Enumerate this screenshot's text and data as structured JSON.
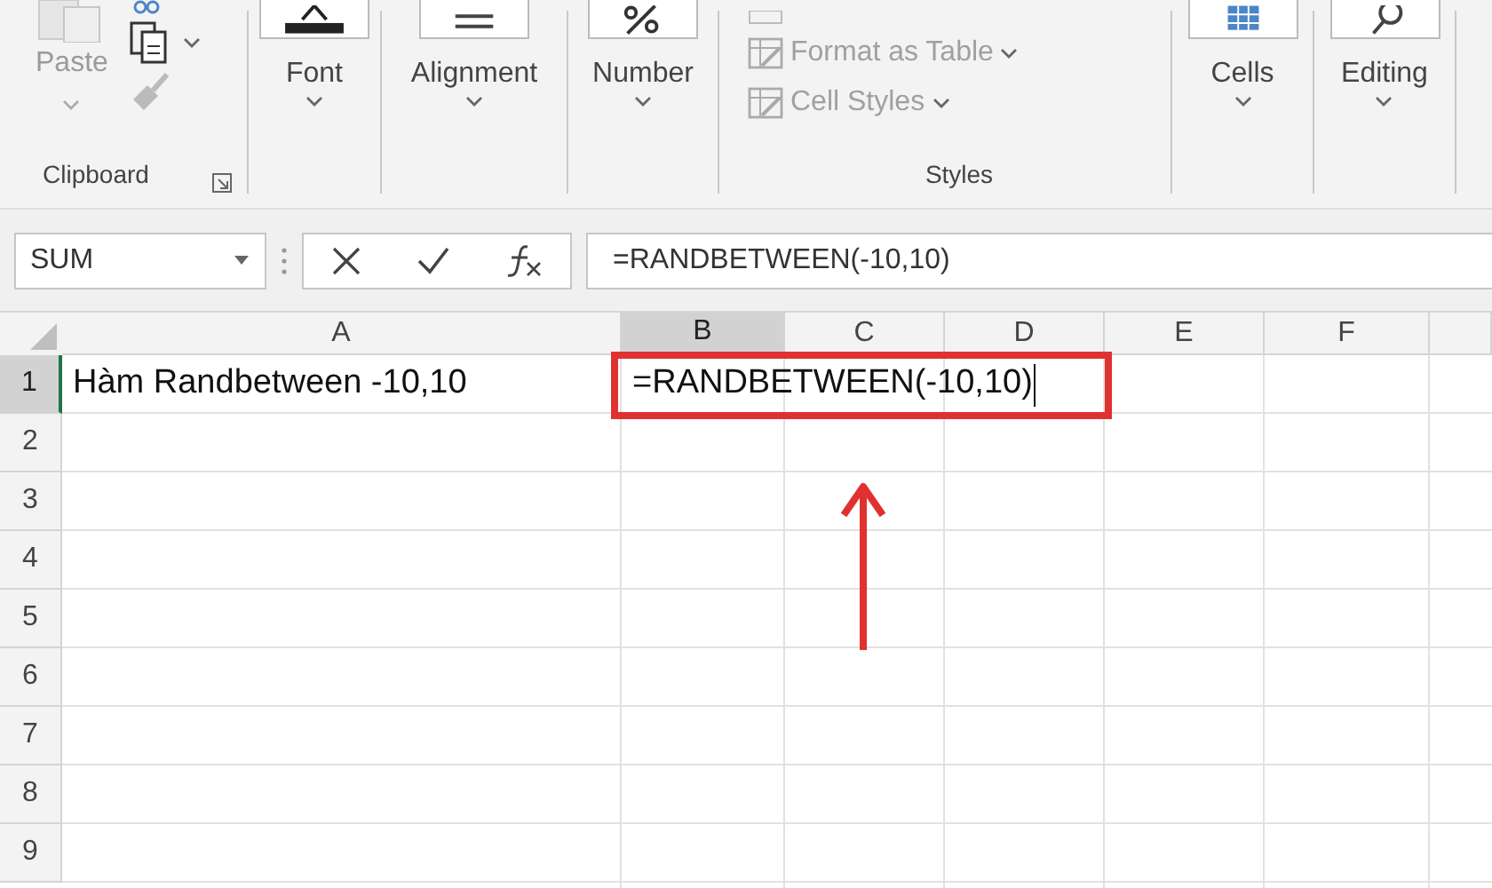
{
  "ribbon": {
    "groups": [
      {
        "kind": "clipboard",
        "label": "Clipboard",
        "paste": {
          "label": "Paste",
          "disabled": true
        }
      },
      {
        "kind": "dropdown",
        "label": "Font"
      },
      {
        "kind": "dropdown",
        "label": "Alignment"
      },
      {
        "kind": "dropdown",
        "label": "Number"
      },
      {
        "kind": "styles",
        "label": "Styles",
        "commands": [
          "Format as Table",
          "Cell Styles"
        ]
      },
      {
        "kind": "dropdown",
        "label": "Cells"
      },
      {
        "kind": "dropdown",
        "label": "Editing"
      }
    ]
  },
  "formula_bar": {
    "name_box": "SUM",
    "formula": "=RANDBETWEEN(-10,10)"
  },
  "sheet": {
    "columns": [
      {
        "label": "A",
        "selected": false
      },
      {
        "label": "B",
        "selected": true
      },
      {
        "label": "C",
        "selected": false
      },
      {
        "label": "D",
        "selected": false
      },
      {
        "label": "E",
        "selected": false
      },
      {
        "label": "F",
        "selected": false
      }
    ],
    "rows": [
      {
        "label": "1",
        "selected": true,
        "cells": [
          {
            "text": "Hàm Randbetween -10,10",
            "editing": false
          },
          {
            "text": "=RANDBETWEEN(-10,10)",
            "editing": true
          }
        ]
      },
      {
        "label": "2",
        "selected": false,
        "cells": []
      },
      {
        "label": "3",
        "selected": false,
        "cells": []
      },
      {
        "label": "4",
        "selected": false,
        "cells": []
      },
      {
        "label": "5",
        "selected": false,
        "cells": []
      },
      {
        "label": "6",
        "selected": false,
        "cells": []
      },
      {
        "label": "7",
        "selected": false,
        "cells": []
      },
      {
        "label": "8",
        "selected": false,
        "cells": []
      },
      {
        "label": "9",
        "selected": false,
        "cells": []
      }
    ]
  }
}
